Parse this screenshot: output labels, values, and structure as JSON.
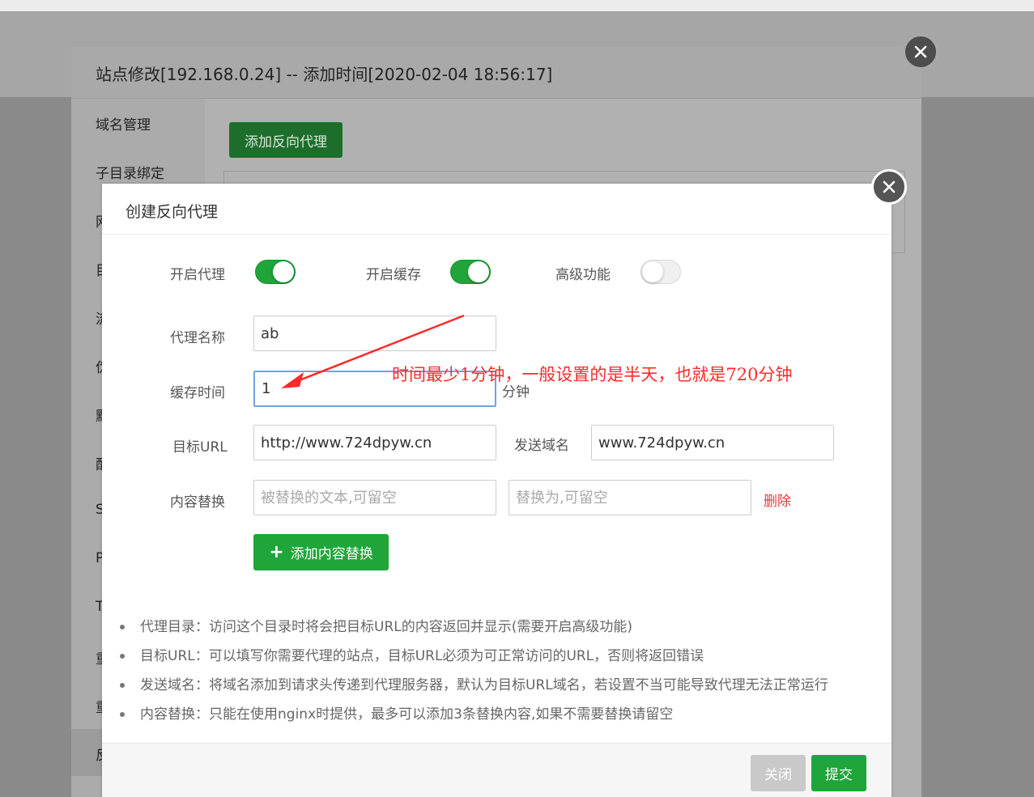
{
  "outer": {
    "title": "站点修改[192.168.0.24] -- 添加时间[2020-02-04 18:56:17]",
    "sidebar": [
      {
        "label": "域名管理"
      },
      {
        "label": "子目录绑定"
      },
      {
        "label": "网"
      },
      {
        "label": "目"
      },
      {
        "label": "流"
      },
      {
        "label": "伪"
      },
      {
        "label": "默"
      },
      {
        "label": "配"
      },
      {
        "label": "S"
      },
      {
        "label": "P"
      },
      {
        "label": "T"
      },
      {
        "label": "重"
      },
      {
        "label": "重"
      },
      {
        "label": "反"
      }
    ],
    "add_button": "添加反向代理"
  },
  "dialog": {
    "title": "创建反向代理",
    "toggles": {
      "proxy": {
        "label": "开启代理",
        "on": true
      },
      "cache": {
        "label": "开启缓存",
        "on": true
      },
      "advanced": {
        "label": "高级功能",
        "on": false
      }
    },
    "fields": {
      "proxy_name": {
        "label": "代理名称",
        "value": "ab"
      },
      "cache_time": {
        "label": "缓存时间",
        "value": "1",
        "unit": "分钟"
      },
      "target_url": {
        "label": "目标URL",
        "value": "http://www.724dpyw.cn"
      },
      "send_domain": {
        "label": "发送域名",
        "value": "www.724dpyw.cn"
      },
      "content_replace": {
        "label": "内容替换",
        "from_placeholder": "被替换的文本,可留空",
        "to_placeholder": "替换为,可留空",
        "delete_label": "删除"
      }
    },
    "add_replace_button": "添加内容替换",
    "tips": [
      "代理目录：访问这个目录时将会把目标URL的内容返回并显示(需要开启高级功能)",
      "目标URL：可以填写你需要代理的站点，目标URL必须为可正常访问的URL，否则将返回错误",
      "发送域名：将域名添加到请求头传递到代理服务器，默认为目标URL域名，若设置不当可能导致代理无法正常运行",
      "内容替换：只能在使用nginx时提供，最多可以添加3条替换内容,如果不需要替换请留空"
    ],
    "footer": {
      "close": "关闭",
      "submit": "提交"
    }
  },
  "annotation": {
    "text": "时间最少1分钟，一般设置的是半天，也就是720分钟",
    "color": "#ff2a2a"
  },
  "colors": {
    "primary": "#20a53a",
    "danger": "#e4393c"
  }
}
